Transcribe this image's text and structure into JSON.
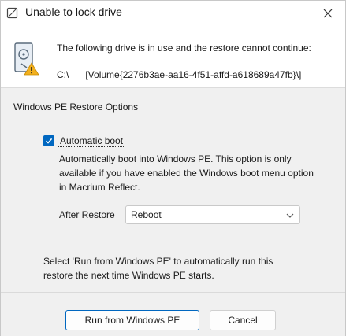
{
  "window": {
    "title": "Unable to lock drive"
  },
  "message": {
    "text": "The following drive is  in use and the restore cannot continue:",
    "drive_letter": "C:\\",
    "volume": "[Volume{2276b3ae-aa16-4f51-affd-a618689a47fb}\\]"
  },
  "options": {
    "section_title": "Windows PE Restore Options",
    "automatic_boot_label": "Automatic boot",
    "automatic_boot_checked": true,
    "description": "Automatically boot into Windows PE. This option is only available if you have enabled the Windows boot menu option in Macrium Reflect.",
    "after_restore_label": "After Restore",
    "after_restore_value": "Reboot"
  },
  "hint": "Select 'Run from Windows PE' to automatically run this restore the next time Windows PE starts.",
  "buttons": {
    "primary": "Run from Windows PE",
    "cancel": "Cancel"
  },
  "colors": {
    "accent": "#0067c0",
    "warning": "#f2b01e"
  }
}
